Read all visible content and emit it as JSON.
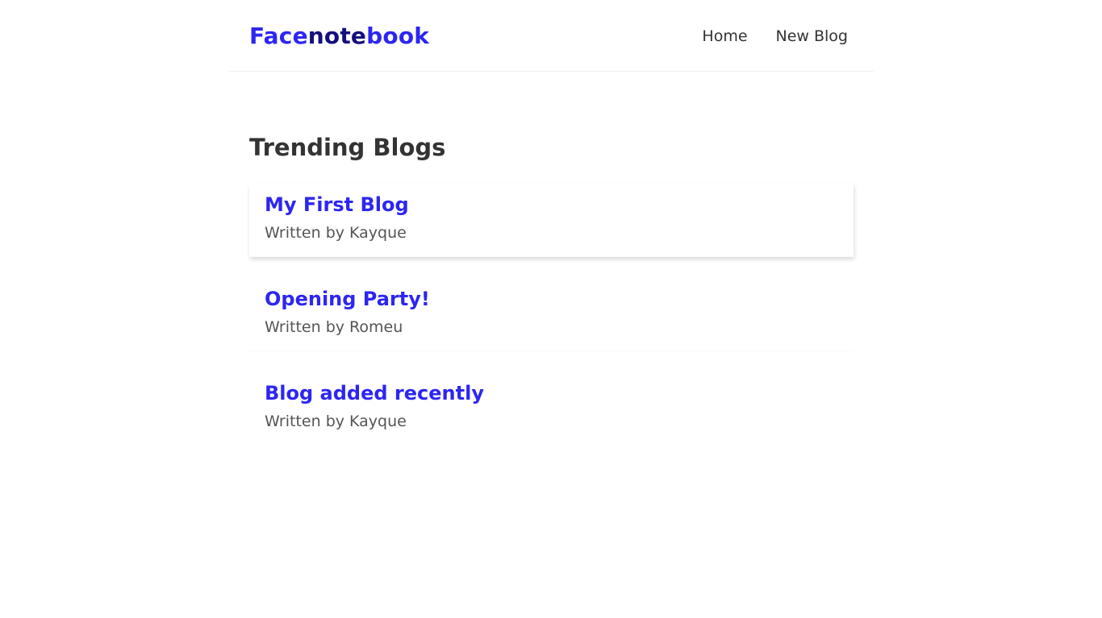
{
  "colors": {
    "brand": "#2d26f0",
    "brand_dark": "#140f7a",
    "text": "#333333",
    "muted": "#555555"
  },
  "navbar": {
    "brand_parts": [
      "Face",
      "note",
      "book"
    ],
    "links": [
      {
        "label": "Home"
      },
      {
        "label": "New Blog"
      }
    ]
  },
  "main": {
    "title": "Trending Blogs",
    "blogs": [
      {
        "title": "My First Blog",
        "author": "Written by Kayque"
      },
      {
        "title": "Opening Party!",
        "author": "Written by Romeu"
      },
      {
        "title": "Blog added recently",
        "author": "Written by Kayque"
      }
    ]
  }
}
